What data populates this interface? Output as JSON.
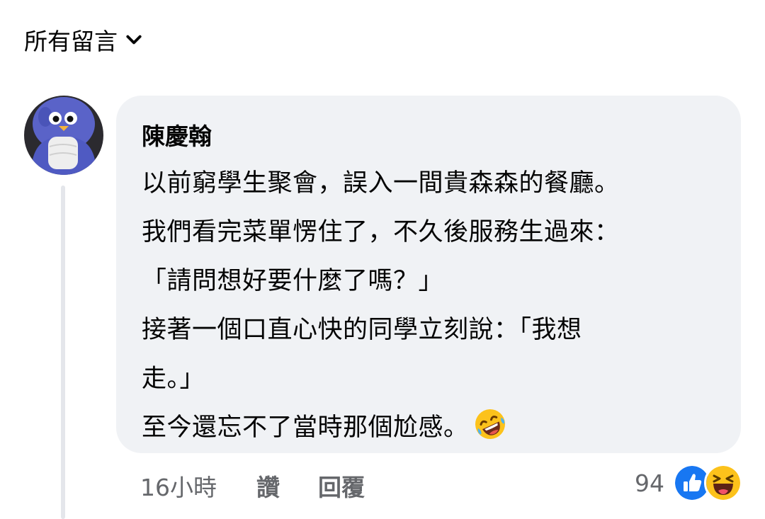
{
  "sort": {
    "label": "所有留言"
  },
  "comment": {
    "author": "陳慶翰",
    "lines": [
      "以前窮學生聚會，誤入一間貴森森的餐廳。",
      "我們看完菜單愣住了，不久後服務生過來：",
      "「請問想好要什麼了嗎？」",
      "接著一個口直心快的同學立刻說：「我想",
      "走。」",
      "至今還忘不了當時那個尬感。"
    ],
    "trailing_emoji": "rolling-on-floor-laughing",
    "timestamp": "16小時",
    "like_label": "讚",
    "reply_label": "回覆",
    "reaction_count": "94",
    "reactions": [
      "like",
      "haha"
    ]
  },
  "colors": {
    "bubble_bg": "#f0f2f5",
    "secondary_text": "#65676b",
    "like_blue": "#1877f2",
    "emoji_yellow": "#fcc21b"
  }
}
